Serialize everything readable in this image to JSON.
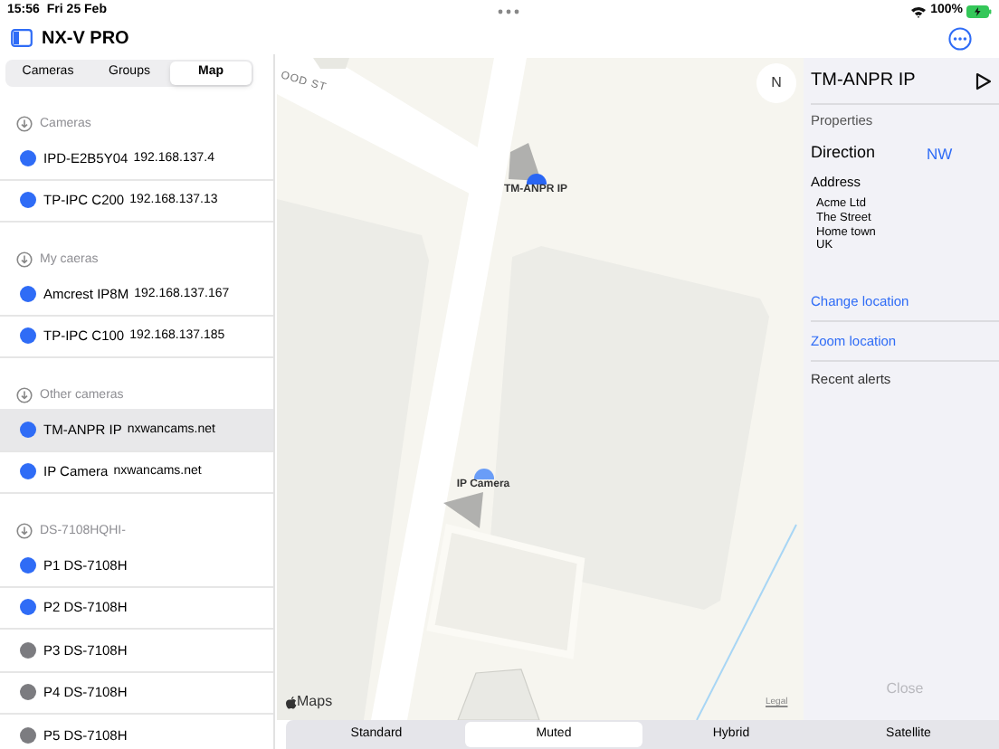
{
  "status_bar": {
    "time": "15:56",
    "date": "Fri 25 Feb",
    "battery": "100%"
  },
  "app": {
    "title": "NX-V PRO"
  },
  "sidebar": {
    "tabs": [
      {
        "label": "Cameras",
        "selected": false
      },
      {
        "label": "Groups",
        "selected": false
      },
      {
        "label": "Map",
        "selected": true
      }
    ],
    "sections": [
      {
        "title": "Cameras",
        "items": [
          {
            "name": "IPD-E2B5Y04",
            "address": "192.168.137.4",
            "color": "#2f6cf6",
            "selected": false
          },
          {
            "name": "TP-IPC C200",
            "address": "192.168.137.13",
            "color": "#2f6cf6",
            "selected": false
          }
        ]
      },
      {
        "title": "My caeras",
        "items": [
          {
            "name": "Amcrest IP8M",
            "address": "192.168.137.167",
            "color": "#2f6cf6",
            "selected": false
          },
          {
            "name": "TP-IPC C100",
            "address": "192.168.137.185",
            "color": "#2f6cf6",
            "selected": false
          }
        ]
      },
      {
        "title": "Other cameras",
        "items": [
          {
            "name": "TM-ANPR IP",
            "address": "nxwancams.net",
            "color": "#2f6cf6",
            "selected": true
          },
          {
            "name": "IP Camera",
            "address": "nxwancams.net",
            "color": "#2f6cf6",
            "selected": false
          }
        ]
      },
      {
        "title": "DS-7108HQHI-",
        "items": [
          {
            "name": "P1 DS-7108H",
            "color": "#2f6cf6",
            "selected": false
          },
          {
            "name": "P2 DS-7108H",
            "color": "#2f6cf6",
            "selected": false
          },
          {
            "name": "P3 DS-7108H",
            "color": "#7c7c80",
            "selected": false
          },
          {
            "name": "P4 DS-7108H",
            "color": "#7c7c80",
            "selected": false
          },
          {
            "name": "P5 DS-7108H",
            "color": "#7c7c80",
            "selected": false
          }
        ]
      }
    ]
  },
  "map": {
    "street_label": "OOD ST",
    "compass": "N",
    "markers": [
      {
        "label": "TM-ANPR IP",
        "selected": true
      },
      {
        "label": "IP Camera",
        "selected": false
      }
    ],
    "attribution": "Maps",
    "legal": "Legal",
    "map_types": [
      {
        "label": "Standard",
        "selected": false
      },
      {
        "label": "Muted",
        "selected": true
      },
      {
        "label": "Hybrid",
        "selected": false
      },
      {
        "label": "Satellite",
        "selected": false
      }
    ]
  },
  "details": {
    "title": "TM-ANPR IP",
    "properties_label": "Properties",
    "direction_label": "Direction",
    "direction_value": "NW",
    "address_label": "Address",
    "address_lines": [
      "Acme Ltd",
      "The Street",
      "Home town",
      "UK"
    ],
    "actions": [
      "Change location",
      "Zoom location"
    ],
    "recent_alerts_label": "Recent alerts",
    "close": {
      "label": "Close",
      "disabled": true
    }
  }
}
